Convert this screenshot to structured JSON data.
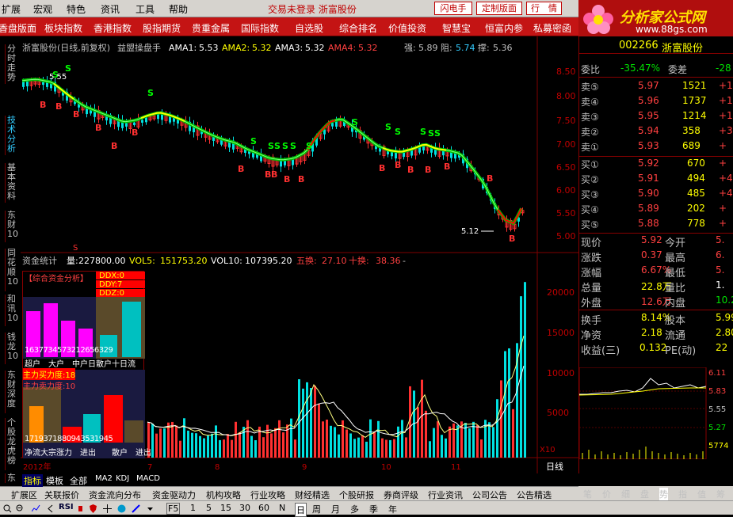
{
  "menu": {
    "items": [
      "扩展",
      "宏观",
      "特色",
      "资讯",
      "工具",
      "帮助"
    ],
    "notice": "交易未登录 浙富股份",
    "btn_flash": "闪电手",
    "btn_custom": "定制版面",
    "btn_quote": "行　情"
  },
  "tabs": [
    "香盘版面",
    "板块指数",
    "香港指数",
    "股指期货",
    "贵重金属",
    "国际指数",
    "自选股",
    "综合排名",
    "价值投资",
    "智慧宝",
    "恒富内参",
    "私募密函"
  ],
  "logo": {
    "brand": "分析家公式网",
    "url": "www.88gs.com"
  },
  "side_tabs": [
    "分时走势",
    "技术分析",
    "基本资料",
    "东财10",
    "同花顺10",
    "和讯10",
    "钱龙10",
    "东财深度",
    "个股龙虎榜",
    "东"
  ],
  "main": {
    "header": {
      "title": "浙富股份(日线,前复权)",
      "indicator": "益盟操盘手",
      "ama1_label": "AMA1:",
      "ama1": "5.53",
      "ama2_label": "AMA2:",
      "ama2": "5.32",
      "ama3_label": "AMA3:",
      "ama3": "5.32",
      "ama4_label": "AMA4:",
      "ama4": "5.32",
      "strong_label": "强:",
      "strong": "5.89",
      "resist_label": "阻:",
      "resist": "5.74",
      "support_label": "撑:",
      "support": "5.36"
    },
    "price_axis": [
      "8.50",
      "8.00",
      "7.50",
      "7.00",
      "6.50",
      "6.00",
      "5.50",
      "5.00"
    ],
    "high_label": "5.55",
    "low_label": "5.12",
    "mid_s": "S",
    "vol_header": {
      "title": "资金统计",
      "vol_label": "量:",
      "vol": "227800.00",
      "vol5_label": "VOL5:",
      "vol5": "151753.20",
      "vol10_label": "VOL10:",
      "vol10": "107395.20",
      "wuhuan_label": "五换:",
      "wuhuan": "27.10",
      "shihuan_label": "十换:",
      "shihuan": "38.36",
      "dash": "-"
    },
    "vol_axis": [
      "20000",
      "15000",
      "10000",
      "5000"
    ],
    "x10": "X10",
    "date_axis": [
      "2012年",
      "7",
      "8",
      "9",
      "10",
      "11"
    ],
    "period": "日线",
    "fund_box": {
      "title": "【综合资金分析】",
      "ddx": "DDX:0",
      "ddy": "DDY:7",
      "ddz": "DDZ:0",
      "nums1": "1637734573212656329",
      "labels1": "超户　大户　中户日散户十日流",
      "zhuli": "主力买力度:18",
      "zhuli2": "主力卖力度:10",
      "nums2": "1719371880943531945",
      "labels2": "净流大宗涨力　进出　　散户　进出"
    },
    "sub_tabs": [
      "指标",
      "模板",
      "全部",
      "MA2",
      "KDJ",
      "MACD"
    ]
  },
  "quotes": {
    "code": "002266",
    "name": "浙富股份",
    "weibi_label": "委比",
    "weibi": "-35.47%",
    "weicha_label": "委差",
    "weicha": "-28",
    "sells": [
      {
        "label": "卖⑤",
        "price": "5.97",
        "vol": "1521",
        "chg": "+1"
      },
      {
        "label": "卖④",
        "price": "5.96",
        "vol": "1737",
        "chg": "+17"
      },
      {
        "label": "卖③",
        "price": "5.95",
        "vol": "1214",
        "chg": "+12"
      },
      {
        "label": "卖②",
        "price": "5.94",
        "vol": "358",
        "chg": "+3"
      },
      {
        "label": "卖①",
        "price": "5.93",
        "vol": "689",
        "chg": "+"
      }
    ],
    "buys": [
      {
        "label": "买①",
        "price": "5.92",
        "vol": "670",
        "chg": "+"
      },
      {
        "label": "买②",
        "price": "5.91",
        "vol": "494",
        "chg": "+4"
      },
      {
        "label": "买③",
        "price": "5.90",
        "vol": "485",
        "chg": "+4"
      },
      {
        "label": "买④",
        "price": "5.89",
        "vol": "202",
        "chg": "+"
      },
      {
        "label": "买⑤",
        "price": "5.88",
        "vol": "778",
        "chg": "+"
      }
    ],
    "stats": [
      {
        "l1": "现价",
        "v1": "5.92",
        "l2": "今开",
        "v2": "5."
      },
      {
        "l1": "涨跌",
        "v1": "0.37",
        "l2": "最高",
        "v2": "6."
      },
      {
        "l1": "涨幅",
        "v1": "6.67%",
        "l2": "最低",
        "v2": "5."
      },
      {
        "l1": "总量",
        "v1": "22.8万",
        "l2": "量比",
        "v2": "1."
      },
      {
        "l1": "外盘",
        "v1": "12.6万",
        "l2": "内盘",
        "v2": "10.2"
      },
      {
        "l1": "换手",
        "v1": "8.14%",
        "l2": "股本",
        "v2": "5.99"
      },
      {
        "l1": "净资",
        "v1": "2.18",
        "l2": "流通",
        "v2": "2.80"
      },
      {
        "l1": "收益(三)",
        "v1": "0.132",
        "l2": "PE(动)",
        "v2": "22"
      }
    ],
    "mini_axis": [
      "6.11",
      "5.83",
      "5.55",
      "5.27"
    ],
    "mini_vol": "5774",
    "bottom_tabs": [
      "笔",
      "价",
      "细",
      "盘",
      "势",
      "指",
      "值",
      "筹"
    ]
  },
  "nav": [
    "扩展区",
    "关联报价",
    "资金流向分布",
    "资金驱动力",
    "机构攻略",
    "行业攻略",
    "财经精选",
    "个股研报",
    "券商评级",
    "行业资讯",
    "公司公告",
    "公告精选"
  ],
  "toolbar": [
    "F5",
    "1",
    "5",
    "15",
    "30",
    "60",
    "N",
    "日",
    "周",
    "月",
    "多",
    "季",
    "年"
  ]
}
